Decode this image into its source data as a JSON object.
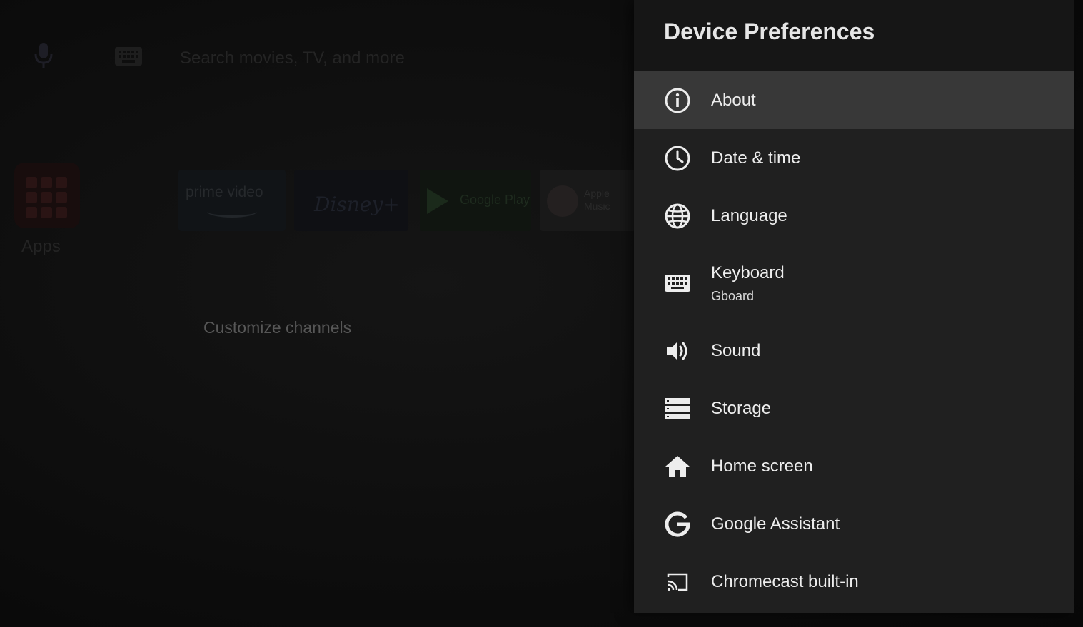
{
  "home": {
    "search_placeholder": "Search movies, TV, and more",
    "apps_label": "Apps",
    "tiles": {
      "prime": "prime video",
      "disney": "Disney+",
      "play": "Google Play",
      "music": "Apple Music"
    },
    "customize_label": "Customize channels"
  },
  "panel": {
    "title": "Device Preferences",
    "items": [
      {
        "label": "About",
        "icon": "info-icon",
        "selected": true
      },
      {
        "label": "Date & time",
        "icon": "clock-icon"
      },
      {
        "label": "Language",
        "icon": "globe-icon"
      },
      {
        "label": "Keyboard",
        "sublabel": "Gboard",
        "icon": "keyboard-icon"
      },
      {
        "label": "Sound",
        "icon": "speaker-icon"
      },
      {
        "label": "Storage",
        "icon": "storage-icon"
      },
      {
        "label": "Home screen",
        "icon": "home-icon"
      },
      {
        "label": "Google Assistant",
        "icon": "google-g-icon"
      },
      {
        "label": "Chromecast built-in",
        "icon": "cast-icon"
      }
    ]
  },
  "colors": {
    "panel_bg": "#202020",
    "header_bg": "#161616",
    "selected_bg": "#383838",
    "text": "#ededed"
  }
}
